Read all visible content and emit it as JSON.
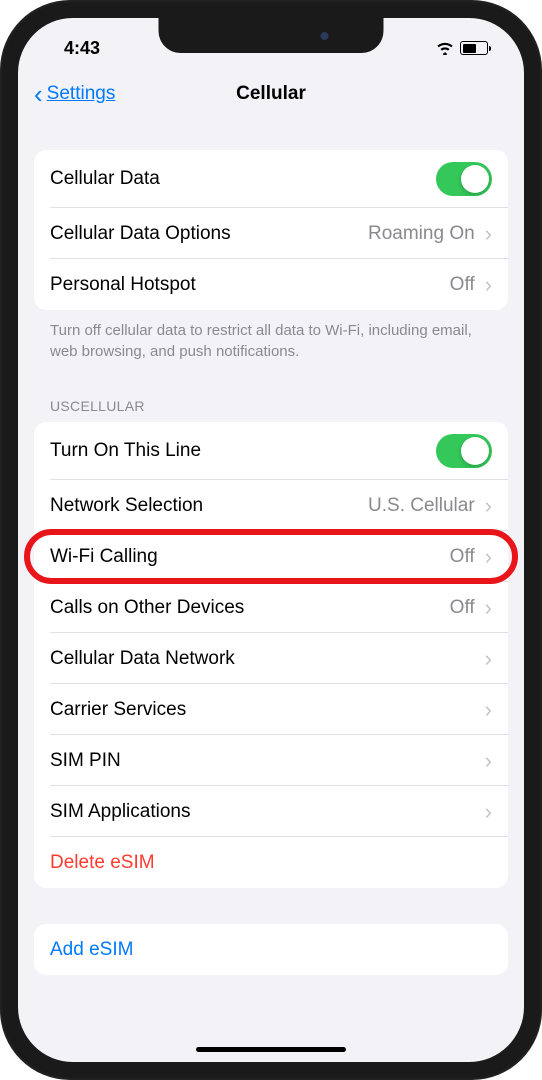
{
  "status": {
    "time": "4:43"
  },
  "nav": {
    "back_label": "Settings",
    "title": "Cellular"
  },
  "section1": {
    "rows": [
      {
        "label": "Cellular Data",
        "type": "toggle",
        "on": true
      },
      {
        "label": "Cellular Data Options",
        "value": "Roaming On"
      },
      {
        "label": "Personal Hotspot",
        "value": "Off"
      }
    ],
    "footer": "Turn off cellular data to restrict all data to Wi-Fi, including email, web browsing, and push notifications."
  },
  "section2": {
    "header": "USCELLULAR",
    "rows": [
      {
        "label": "Turn On This Line",
        "type": "toggle",
        "on": true
      },
      {
        "label": "Network Selection",
        "value": "U.S. Cellular"
      },
      {
        "label": "Wi-Fi Calling",
        "value": "Off",
        "highlighted": true
      },
      {
        "label": "Calls on Other Devices",
        "value": "Off"
      },
      {
        "label": "Cellular Data Network"
      },
      {
        "label": "Carrier Services"
      },
      {
        "label": "SIM PIN"
      },
      {
        "label": "SIM Applications"
      },
      {
        "label": "Delete eSIM",
        "destructive": true
      }
    ]
  },
  "section3": {
    "rows": [
      {
        "label": "Add eSIM",
        "link": true
      }
    ]
  }
}
